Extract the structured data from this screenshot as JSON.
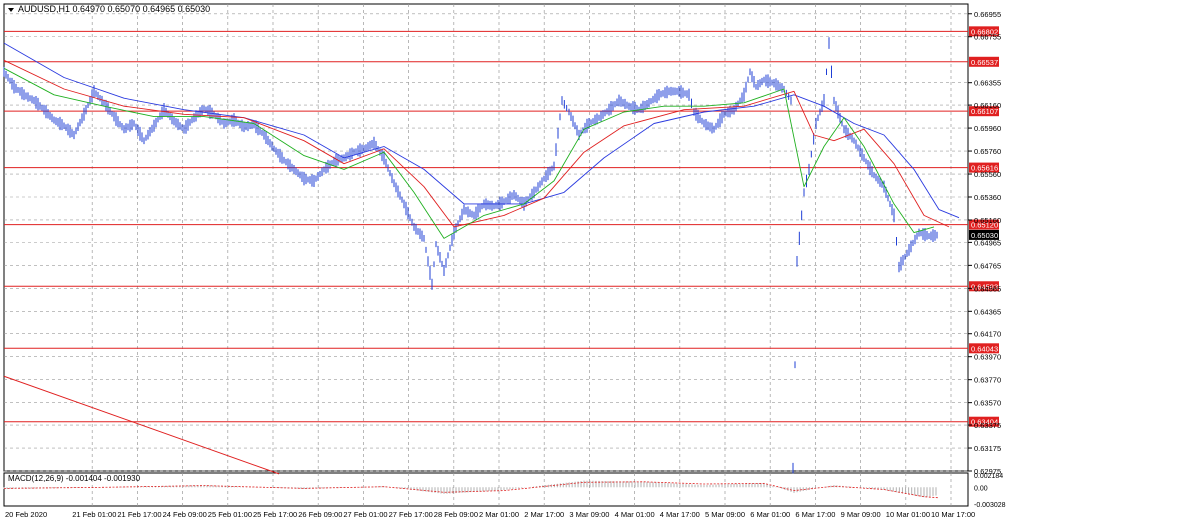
{
  "header": {
    "symbol_text": "AUDUSD,H1  0.64970 0.65070 0.64965 0.65030",
    "indicator_text": "MACD(12,26,9) -0.001404 -0.001930"
  },
  "colors": {
    "price": "#1f3fd6",
    "ma_fast": "#20b020",
    "ma_mid": "#e02020",
    "ma_slow": "#2a3adf",
    "level": "#e02020",
    "grid": "#9a9a9a",
    "macd": "#b0b0b0",
    "signal": "#e02020"
  },
  "chart_data": {
    "type": "line",
    "symbol": "AUDUSD",
    "timeframe": "H1",
    "ohlc_header": {
      "open": 0.6497,
      "high": 0.6507,
      "low": 0.64965,
      "close": 0.6503
    },
    "y_axis_ticks": [
      "0.66955",
      "0.66755",
      "0.66355",
      "0.66160",
      "0.65960",
      "0.65760",
      "0.65560",
      "0.65360",
      "0.65160",
      "0.64965",
      "0.64765",
      "0.64565",
      "0.64365",
      "0.64170",
      "0.63970",
      "0.63770",
      "0.63570",
      "0.63375",
      "0.63175",
      "0.62975"
    ],
    "ylim": [
      0.62975,
      0.6704
    ],
    "x_axis_labels": [
      "20 Feb 2020",
      "21 Feb 01:00",
      "21 Feb 17:00",
      "24 Feb 09:00",
      "25 Feb 01:00",
      "25 Feb 17:00",
      "26 Feb 09:00",
      "27 Feb 01:00",
      "27 Feb 17:00",
      "28 Feb 09:00",
      "2 Mar 01:00",
      "2 Mar 17:00",
      "3 Mar 09:00",
      "4 Mar 01:00",
      "4 Mar 17:00",
      "5 Mar 09:00",
      "6 Mar 01:00",
      "6 Mar 17:00",
      "9 Mar 09:00",
      "10 Mar 01:00",
      "10 Mar 17:00"
    ],
    "levels": [
      "0.66802",
      "0.66537",
      "0.66107",
      "0.65616",
      "0.65120",
      "0.64583",
      "0.64043",
      "0.63404"
    ],
    "current_price": "0.65030",
    "price_series": [
      [
        0,
        0.6645
      ],
      [
        10,
        0.6632
      ],
      [
        20,
        0.6625
      ],
      [
        30,
        0.662
      ],
      [
        40,
        0.6612
      ],
      [
        50,
        0.6603
      ],
      [
        60,
        0.6598
      ],
      [
        70,
        0.659
      ],
      [
        80,
        0.6608
      ],
      [
        90,
        0.6628
      ],
      [
        100,
        0.6618
      ],
      [
        110,
        0.6606
      ],
      [
        120,
        0.6595
      ],
      [
        130,
        0.66
      ],
      [
        140,
        0.6585
      ],
      [
        150,
        0.6598
      ],
      [
        160,
        0.6612
      ],
      [
        170,
        0.6602
      ],
      [
        180,
        0.6595
      ],
      [
        190,
        0.6605
      ],
      [
        200,
        0.6613
      ],
      [
        210,
        0.6608
      ],
      [
        220,
        0.66
      ],
      [
        230,
        0.6603
      ],
      [
        240,
        0.6597
      ],
      [
        250,
        0.6599
      ],
      [
        260,
        0.659
      ],
      [
        270,
        0.6578
      ],
      [
        280,
        0.6568
      ],
      [
        290,
        0.656
      ],
      [
        300,
        0.6552
      ],
      [
        310,
        0.655
      ],
      [
        320,
        0.656
      ],
      [
        330,
        0.6567
      ],
      [
        340,
        0.657
      ],
      [
        350,
        0.6575
      ],
      [
        360,
        0.6578
      ],
      [
        370,
        0.6583
      ],
      [
        380,
        0.657
      ],
      [
        390,
        0.6548
      ],
      [
        400,
        0.653
      ],
      [
        410,
        0.651
      ],
      [
        420,
        0.65
      ],
      [
        428,
        0.646
      ],
      [
        432,
        0.6495
      ],
      [
        440,
        0.6472
      ],
      [
        450,
        0.6505
      ],
      [
        460,
        0.6525
      ],
      [
        470,
        0.652
      ],
      [
        480,
        0.653
      ],
      [
        490,
        0.6528
      ],
      [
        500,
        0.6532
      ],
      [
        510,
        0.6538
      ],
      [
        520,
        0.653
      ],
      [
        530,
        0.654
      ],
      [
        540,
        0.6552
      ],
      [
        550,
        0.6563
      ],
      [
        558,
        0.662
      ],
      [
        565,
        0.661
      ],
      [
        575,
        0.659
      ],
      [
        585,
        0.66
      ],
      [
        595,
        0.6605
      ],
      [
        605,
        0.6612
      ],
      [
        615,
        0.662
      ],
      [
        625,
        0.6615
      ],
      [
        635,
        0.6612
      ],
      [
        645,
        0.6618
      ],
      [
        655,
        0.6625
      ],
      [
        665,
        0.6628
      ],
      [
        675,
        0.6628
      ],
      [
        685,
        0.6625
      ],
      [
        690,
        0.661
      ],
      [
        700,
        0.66
      ],
      [
        710,
        0.6595
      ],
      [
        720,
        0.6608
      ],
      [
        730,
        0.6612
      ],
      [
        740,
        0.6625
      ],
      [
        746,
        0.6645
      ],
      [
        752,
        0.6632
      ],
      [
        760,
        0.6638
      ],
      [
        770,
        0.6635
      ],
      [
        780,
        0.663
      ],
      [
        787,
        0.662
      ],
      [
        789,
        0.63
      ],
      [
        793,
        0.648
      ],
      [
        800,
        0.654
      ],
      [
        805,
        0.656
      ],
      [
        812,
        0.66
      ],
      [
        820,
        0.662
      ],
      [
        825,
        0.667
      ],
      [
        830,
        0.662
      ],
      [
        840,
        0.6595
      ],
      [
        850,
        0.6585
      ],
      [
        860,
        0.657
      ],
      [
        870,
        0.6555
      ],
      [
        880,
        0.6545
      ],
      [
        890,
        0.652
      ],
      [
        895,
        0.6475
      ],
      [
        905,
        0.649
      ],
      [
        915,
        0.6505
      ],
      [
        925,
        0.6502
      ],
      [
        935,
        0.6503
      ]
    ],
    "ma_fast_series": [
      [
        0,
        0.6648
      ],
      [
        50,
        0.6625
      ],
      [
        100,
        0.6615
      ],
      [
        150,
        0.6606
      ],
      [
        200,
        0.6606
      ],
      [
        250,
        0.66
      ],
      [
        300,
        0.6572
      ],
      [
        340,
        0.656
      ],
      [
        380,
        0.6575
      ],
      [
        410,
        0.654
      ],
      [
        440,
        0.65
      ],
      [
        480,
        0.652
      ],
      [
        520,
        0.653
      ],
      [
        550,
        0.655
      ],
      [
        580,
        0.6595
      ],
      [
        620,
        0.661
      ],
      [
        660,
        0.6615
      ],
      [
        700,
        0.6615
      ],
      [
        740,
        0.6618
      ],
      [
        780,
        0.663
      ],
      [
        800,
        0.6545
      ],
      [
        820,
        0.658
      ],
      [
        840,
        0.6605
      ],
      [
        860,
        0.658
      ],
      [
        890,
        0.653
      ],
      [
        910,
        0.6505
      ],
      [
        930,
        0.651
      ]
    ],
    "ma_mid_series": [
      [
        0,
        0.6655
      ],
      [
        60,
        0.663
      ],
      [
        120,
        0.6615
      ],
      [
        180,
        0.6608
      ],
      [
        240,
        0.6605
      ],
      [
        300,
        0.6585
      ],
      [
        340,
        0.6565
      ],
      [
        380,
        0.6578
      ],
      [
        420,
        0.6545
      ],
      [
        450,
        0.651
      ],
      [
        500,
        0.652
      ],
      [
        540,
        0.6535
      ],
      [
        580,
        0.6575
      ],
      [
        620,
        0.6598
      ],
      [
        680,
        0.6612
      ],
      [
        740,
        0.6615
      ],
      [
        790,
        0.6628
      ],
      [
        810,
        0.659
      ],
      [
        830,
        0.6585
      ],
      [
        860,
        0.6595
      ],
      [
        890,
        0.6565
      ],
      [
        920,
        0.652
      ],
      [
        945,
        0.651
      ]
    ],
    "ma_slow_series": [
      [
        0,
        0.667
      ],
      [
        60,
        0.664
      ],
      [
        120,
        0.6622
      ],
      [
        180,
        0.6612
      ],
      [
        240,
        0.6605
      ],
      [
        300,
        0.659
      ],
      [
        340,
        0.657
      ],
      [
        380,
        0.658
      ],
      [
        420,
        0.656
      ],
      [
        460,
        0.653
      ],
      [
        520,
        0.653
      ],
      [
        560,
        0.654
      ],
      [
        600,
        0.657
      ],
      [
        650,
        0.66
      ],
      [
        700,
        0.661
      ],
      [
        750,
        0.6615
      ],
      [
        790,
        0.6625
      ],
      [
        820,
        0.6615
      ],
      [
        850,
        0.66
      ],
      [
        880,
        0.659
      ],
      [
        910,
        0.656
      ],
      [
        935,
        0.6525
      ],
      [
        955,
        0.6518
      ]
    ],
    "trend_line": [
      [
        0,
        0.638
      ],
      [
        275,
        0.6295
      ]
    ],
    "macd": {
      "value": "-0.001404",
      "signal": "-0.001930",
      "y_ticks": [
        "0.002184",
        "0.00",
        "-0.003028"
      ],
      "hist": [
        [
          0,
          -0.0003
        ],
        [
          100,
          0.0
        ],
        [
          200,
          0.0004
        ],
        [
          300,
          -0.0003
        ],
        [
          380,
          0.0002
        ],
        [
          440,
          -0.0012
        ],
        [
          500,
          -0.0005
        ],
        [
          580,
          0.0012
        ],
        [
          640,
          0.001
        ],
        [
          700,
          0.0004
        ],
        [
          760,
          0.0008
        ],
        [
          790,
          -0.001
        ],
        [
          830,
          0.0004
        ],
        [
          880,
          -0.0005
        ],
        [
          920,
          -0.0018
        ],
        [
          935,
          -0.0014
        ]
      ],
      "signal_series": [
        [
          0,
          -0.0002
        ],
        [
          100,
          0.0
        ],
        [
          200,
          0.0003
        ],
        [
          300,
          -0.0002
        ],
        [
          380,
          0.0001
        ],
        [
          440,
          -0.0009
        ],
        [
          500,
          -0.0006
        ],
        [
          580,
          0.0009
        ],
        [
          640,
          0.001
        ],
        [
          700,
          0.0006
        ],
        [
          760,
          0.0007
        ],
        [
          790,
          -0.0006
        ],
        [
          830,
          0.0002
        ],
        [
          880,
          -0.0004
        ],
        [
          920,
          -0.0017
        ],
        [
          935,
          -0.0019
        ]
      ]
    }
  }
}
